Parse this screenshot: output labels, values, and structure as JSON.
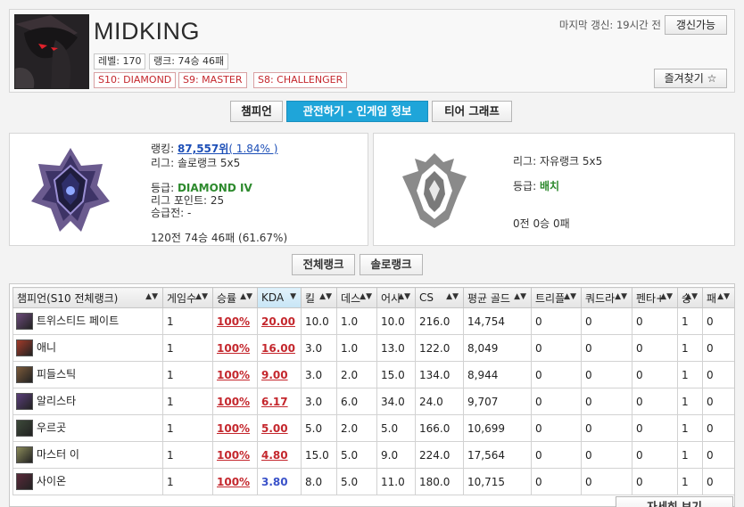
{
  "profile": {
    "name": "MIDKING",
    "level_label": "레벨: 170",
    "rank_record": "랭크: 74승 46패",
    "badges": [
      "S10: DIAMOND",
      "S9: MASTER",
      "S8: CHALLENGER"
    ],
    "last_update": "마지막 갱신: 19시간 전",
    "refresh_label": "갱신가능",
    "favorite_label": "즐겨찾기 ☆"
  },
  "tabs": [
    "챔피언",
    "관전하기 - 인게임 정보",
    "티어 그래프"
  ],
  "solo_panel": {
    "ranking_label": "랭킹: ",
    "ranking_value": "87,557위",
    "ranking_pct": "( 1.84% )",
    "league": "리그: 솔로랭크 5x5",
    "tier_label": "등급: ",
    "tier_value": "DIAMOND IV",
    "points": "리그 포인트: 25",
    "promo": "승급전: -",
    "record": "120전 74승 46패 (61.67%)"
  },
  "flex_panel": {
    "league": "리그: 자유랭크 5x5",
    "tier_label": "등급: ",
    "tier_value": "배치",
    "record": "0전 0승 0패"
  },
  "filters": [
    "전체랭크",
    "솔로랭크"
  ],
  "table": {
    "headers": [
      "챔피언(S10 전체랭크)",
      "게임수",
      "승률",
      "KDA",
      "킬",
      "데스",
      "어시",
      "CS",
      "평균 골드",
      "트리플",
      "쿼드라",
      "펜타+",
      "승",
      "패"
    ],
    "rows": [
      {
        "name": "트위스티드 페이트",
        "color": "#6b4a7a",
        "games": "1",
        "winrate": "100%",
        "kda": "20.00",
        "k": "10.0",
        "d": "1.0",
        "a": "10.0",
        "cs": "216.0",
        "gold": "14,754",
        "triple": "0",
        "quadra": "0",
        "penta": "0",
        "w": "1",
        "l": "0"
      },
      {
        "name": "애니",
        "color": "#a23b2a",
        "games": "1",
        "winrate": "100%",
        "kda": "16.00",
        "k": "3.0",
        "d": "1.0",
        "a": "13.0",
        "cs": "122.0",
        "gold": "8,049",
        "triple": "0",
        "quadra": "0",
        "penta": "0",
        "w": "1",
        "l": "0"
      },
      {
        "name": "피들스틱",
        "color": "#7b5a3a",
        "games": "1",
        "winrate": "100%",
        "kda": "9.00",
        "k": "3.0",
        "d": "2.0",
        "a": "15.0",
        "cs": "134.0",
        "gold": "8,944",
        "triple": "0",
        "quadra": "0",
        "penta": "0",
        "w": "1",
        "l": "0"
      },
      {
        "name": "알리스타",
        "color": "#5a3e7a",
        "games": "1",
        "winrate": "100%",
        "kda": "6.17",
        "k": "3.0",
        "d": "6.0",
        "a": "34.0",
        "cs": "24.0",
        "gold": "9,707",
        "triple": "0",
        "quadra": "0",
        "penta": "0",
        "w": "1",
        "l": "0"
      },
      {
        "name": "우르곳",
        "color": "#3d4a3a",
        "games": "1",
        "winrate": "100%",
        "kda": "5.00",
        "k": "5.0",
        "d": "2.0",
        "a": "5.0",
        "cs": "166.0",
        "gold": "10,699",
        "triple": "0",
        "quadra": "0",
        "penta": "0",
        "w": "1",
        "l": "0"
      },
      {
        "name": "마스터 이",
        "color": "#8a8a5a",
        "games": "1",
        "winrate": "100%",
        "kda": "4.80",
        "k": "15.0",
        "d": "5.0",
        "a": "9.0",
        "cs": "224.0",
        "gold": "17,564",
        "triple": "0",
        "quadra": "0",
        "penta": "0",
        "w": "1",
        "l": "0"
      },
      {
        "name": "사이온",
        "color": "#5a2a3a",
        "games": "1",
        "winrate": "100%",
        "kda": "3.80",
        "k": "8.0",
        "d": "5.0",
        "a": "11.0",
        "cs": "180.0",
        "gold": "10,715",
        "triple": "0",
        "quadra": "0",
        "penta": "0",
        "w": "1",
        "l": "0"
      }
    ],
    "more_label": "자세히 보기"
  }
}
